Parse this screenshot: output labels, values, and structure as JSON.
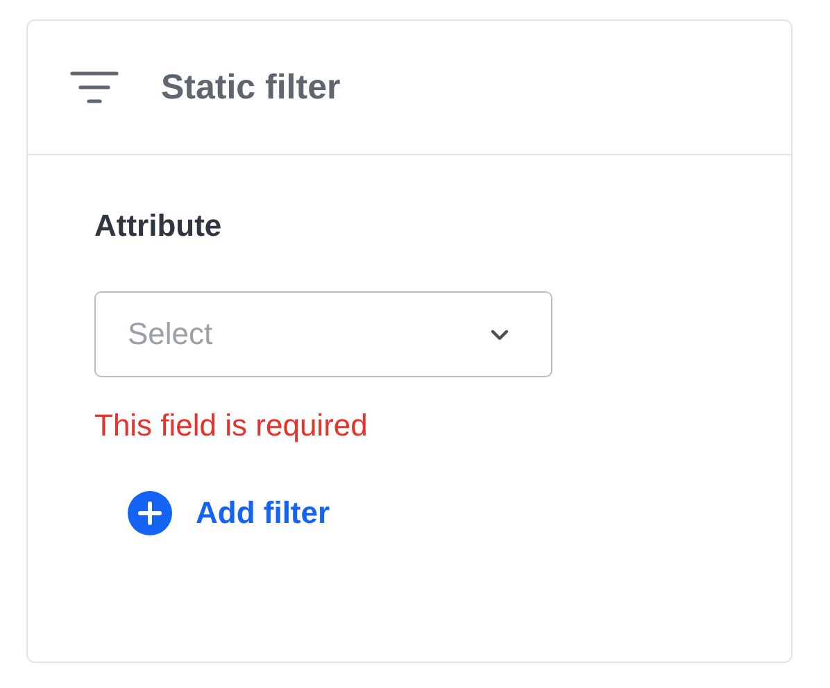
{
  "panel": {
    "title": "Static filter"
  },
  "attribute": {
    "label": "Attribute",
    "placeholder": "Select",
    "error": "This field is required"
  },
  "add_button": {
    "label": "Add filter"
  }
}
